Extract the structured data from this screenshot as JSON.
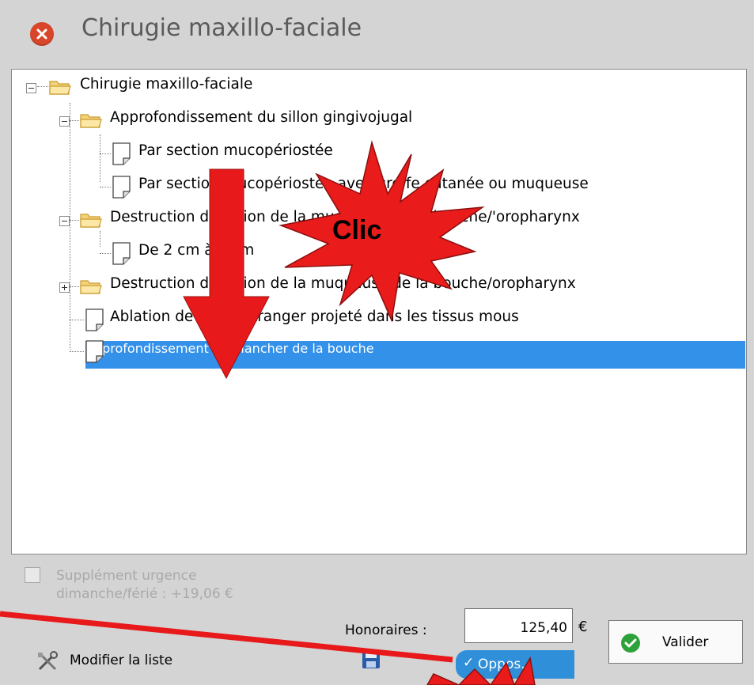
{
  "window": {
    "title": "Chirugie maxillo-faciale"
  },
  "tree": {
    "root": "Chirugie maxillo-faciale",
    "items": [
      "Approfondissement du sillon gingivojugal",
      "Par section mucopériostée",
      "Par section mucopériostée avec greffe cutanée ou muqueuse",
      "Destruction de lésion de la muqueuse de la bouche/'oropharynx",
      "De 2 cm à 4 cm",
      "Destruction de lésion de la muqueuse de la bouche/oropharynx",
      "Ablation de corps étranger projeté dans les tissus mous",
      "Approfondissement du plancher de la bouche"
    ],
    "selected_index": 7
  },
  "footer": {
    "urgence_line1": "Supplément urgence",
    "urgence_line2": "dimanche/férié : +19,06 €",
    "honoraires_label": "Honoraires :",
    "honoraires_value": "125,40",
    "currency": "€",
    "valider_label": "Valider",
    "modifier_label": "Modifier la liste",
    "oppos_label": "Oppos."
  },
  "annotation": {
    "clic_label": "Clic",
    "arrow_color": "#e8191a",
    "star_color": "#ea1b1b"
  },
  "icons": [
    "close-icon",
    "folder-icon",
    "document-icon",
    "checkmark-icon",
    "tools-icon",
    "save-icon"
  ]
}
